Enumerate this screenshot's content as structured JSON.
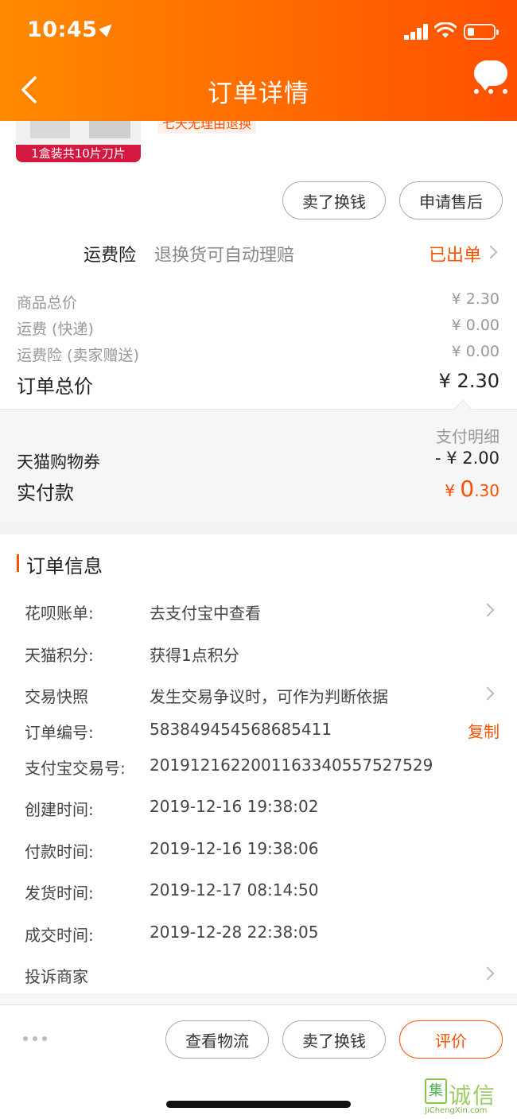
{
  "status_bar": {
    "time": "10:45"
  },
  "header": {
    "title": "订单详情"
  },
  "product": {
    "tag": "1盒装共10片刀片",
    "badge": "七天无理由退换"
  },
  "item_actions": {
    "sell_label": "卖了换钱",
    "after_sale_label": "申请售后"
  },
  "insurance": {
    "label": "运费险",
    "desc": "退换货可自动理赔",
    "status": "已出单"
  },
  "price_breakdown": [
    {
      "label": "商品总价",
      "value": "¥ 2.30"
    },
    {
      "label": "运费 (快递)",
      "value": "¥ 0.00"
    },
    {
      "label": "运费险 (卖家赠送)",
      "value": "¥ 0.00"
    }
  ],
  "order_total": {
    "label": "订单总价",
    "value": "¥ 2.30"
  },
  "payment": {
    "detail_link": "支付明细",
    "coupon_label": "天猫购物券",
    "coupon_value": "- ¥ 2.00",
    "paid_label": "实付款",
    "paid_currency": "¥ ",
    "paid_int": "0",
    "paid_dec": ".30"
  },
  "order_info": {
    "title": "订单信息",
    "rows": [
      {
        "label": "花呗账单:",
        "value": "去支付宝中查看"
      },
      {
        "label": "天猫积分:",
        "value": "获得1点积分"
      },
      {
        "label": "交易快照",
        "value": "发生交易争议时，可作为判断依据"
      },
      {
        "label": "订单编号:",
        "value": "583849454568685411"
      },
      {
        "label": "支付宝交易号:",
        "value": "2019121622001163340557527529"
      },
      {
        "label": "创建时间:",
        "value": "2019-12-16 19:38:02"
      },
      {
        "label": "付款时间:",
        "value": "2019-12-16 19:38:06"
      },
      {
        "label": "发货时间:",
        "value": "2019-12-17 08:14:50"
      },
      {
        "label": "成交时间:",
        "value": "2019-12-28 22:38:05"
      },
      {
        "label": "投诉商家",
        "value": ""
      }
    ],
    "copy_label": "复制"
  },
  "bottom_actions": {
    "logistics": "查看物流",
    "sell": "卖了换钱",
    "review": "评价"
  },
  "watermark": {
    "mark": "集",
    "text": "诚信",
    "url": "JiChengXin.com"
  },
  "colors": {
    "accent": "#ff5000",
    "header_start": "#ff8a00",
    "header_end": "#ff5000"
  }
}
